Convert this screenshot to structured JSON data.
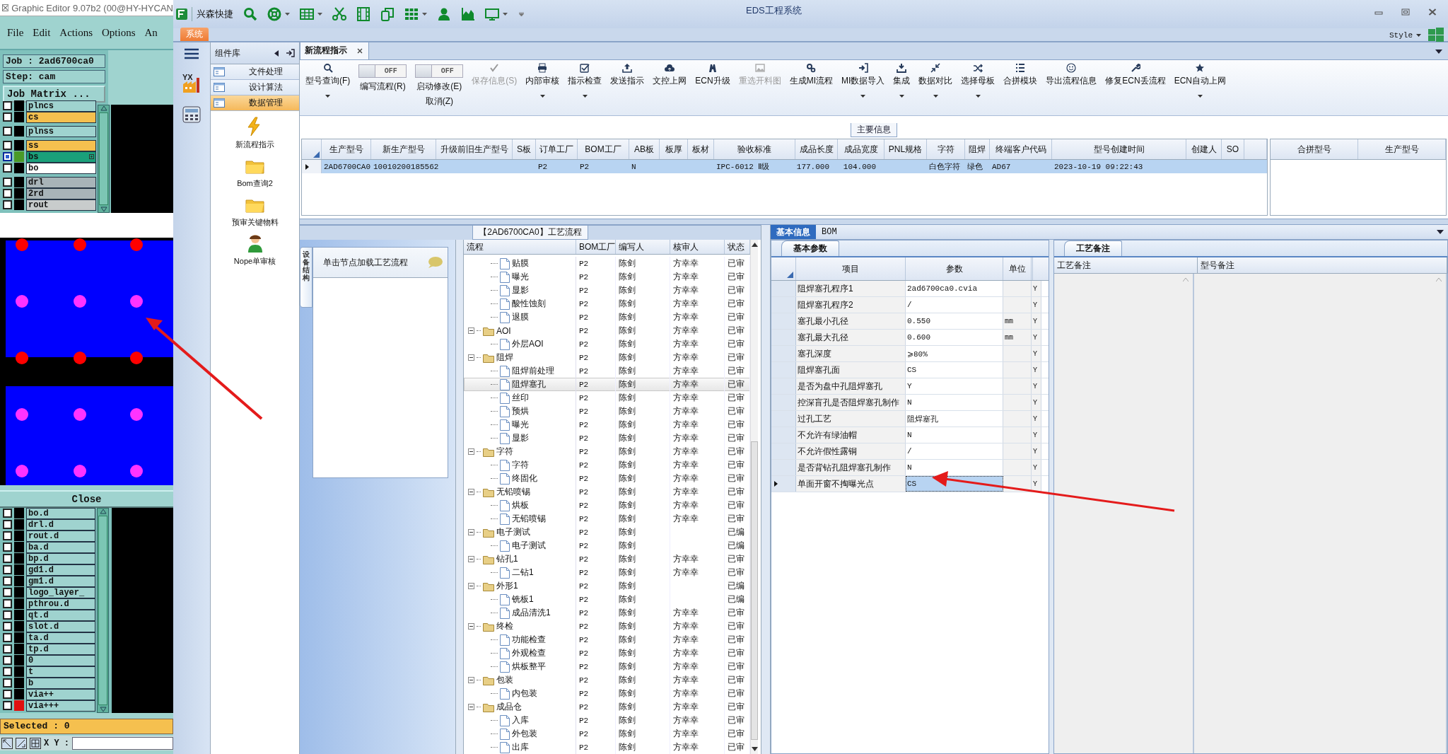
{
  "editor": {
    "title": "Graphic Editor 9.07b2 (00@HY-HYCAN",
    "menu": [
      "File",
      "Edit",
      "Actions",
      "Options",
      "An"
    ],
    "job": "Job : 2ad6700ca0",
    "step": "Step: cam",
    "matrix_button": "Job Matrix ...",
    "layers_top": [
      {
        "name": "plncs",
        "color": "#9fd3cf",
        "swatch": {
          "color": "#000000"
        },
        "selected": false,
        "gap": false
      },
      {
        "name": "cs",
        "color": "#f5c04f",
        "swatch": {
          "color": "#000000"
        },
        "selected": false,
        "gap": false
      },
      {
        "name": "plnss",
        "color": "#9fd3cf",
        "swatch": {
          "color": "#000000"
        },
        "selected": false,
        "gap": true
      },
      {
        "name": "ss",
        "color": "#f5c04f",
        "swatch": {
          "color": "#000000"
        },
        "selected": false,
        "gap": true
      },
      {
        "name": "bs",
        "color": "#1aa07a",
        "swatch": {
          "color": "#4a9a28"
        },
        "selected": true,
        "gap": false
      },
      {
        "name": "bo",
        "color": "#ffffff",
        "swatch": {
          "color": "#000000"
        },
        "selected": false,
        "gap": false
      },
      {
        "name": "drl",
        "color": "#a8b4b8",
        "swatch": {
          "color": "#000000"
        },
        "selected": false,
        "gap": true
      },
      {
        "name": "2rd",
        "color": "#a8b4b8",
        "swatch": {
          "color": "#000000"
        },
        "selected": false,
        "gap": false
      },
      {
        "name": "rout",
        "color": "#c8cccc",
        "swatch": {
          "color": "#000000"
        },
        "selected": false,
        "gap": false
      }
    ],
    "close_button": "Close",
    "layers_bottom": [
      {
        "name": "bo.d",
        "color": "#9fd3cf",
        "swatch": {
          "color": "#000000"
        },
        "selected": false
      },
      {
        "name": "drl.d",
        "color": "#9fd3cf",
        "swatch": {
          "color": "#000000"
        },
        "selected": false
      },
      {
        "name": "rout.d",
        "color": "#9fd3cf",
        "swatch": {
          "color": "#000000"
        },
        "selected": false
      },
      {
        "name": "ba.d",
        "color": "#9fd3cf",
        "swatch": {
          "color": "#000000"
        },
        "selected": false
      },
      {
        "name": "bp.d",
        "color": "#9fd3cf",
        "swatch": {
          "color": "#000000"
        },
        "selected": false
      },
      {
        "name": "gd1.d",
        "color": "#9fd3cf",
        "swatch": {
          "color": "#000000"
        },
        "selected": false
      },
      {
        "name": "gm1.d",
        "color": "#9fd3cf",
        "swatch": {
          "color": "#000000"
        },
        "selected": false
      },
      {
        "name": "logo_layer_",
        "color": "#9fd3cf",
        "swatch": {
          "color": "#000000"
        },
        "selected": false
      },
      {
        "name": "pthrou.d",
        "color": "#9fd3cf",
        "swatch": {
          "color": "#000000"
        },
        "selected": false
      },
      {
        "name": "qt.d",
        "color": "#9fd3cf",
        "swatch": {
          "color": "#000000"
        },
        "selected": false
      },
      {
        "name": "slot.d",
        "color": "#9fd3cf",
        "swatch": {
          "color": "#000000"
        },
        "selected": false
      },
      {
        "name": "ta.d",
        "color": "#9fd3cf",
        "swatch": {
          "color": "#000000"
        },
        "selected": false
      },
      {
        "name": "tp.d",
        "color": "#9fd3cf",
        "swatch": {
          "color": "#000000"
        },
        "selected": false
      },
      {
        "name": "0",
        "color": "#9fd3cf",
        "swatch": {
          "color": "#000000"
        },
        "selected": false
      },
      {
        "name": "t",
        "color": "#9fd3cf",
        "swatch": {
          "color": "#000000"
        },
        "selected": false
      },
      {
        "name": "b",
        "color": "#9fd3cf",
        "swatch": {
          "color": "#000000"
        },
        "selected": false
      },
      {
        "name": "via++",
        "color": "#9fd3cf",
        "swatch": {
          "color": "#000000"
        },
        "selected": false
      },
      {
        "name": "via+++",
        "color": "#9fd3cf",
        "swatch": {
          "color": "#e01010"
        },
        "selected": false
      }
    ],
    "selected_count": "Selected : 0",
    "coords_label": "X Y :"
  },
  "app": {
    "title": "EDS工程系统",
    "brand": "兴森快捷",
    "system_tab": "系统",
    "style_menu": "Style",
    "nav_badge": "YX"
  },
  "sidebar": {
    "title": "组件库",
    "groups": [
      {
        "label": "文件处理",
        "selected": false
      },
      {
        "label": "设计算法",
        "selected": false
      },
      {
        "label": "数据管理",
        "selected": true
      }
    ],
    "items": [
      {
        "label": "新流程指示",
        "kind": "action"
      },
      {
        "label": "Bom查询2",
        "kind": "folder"
      },
      {
        "label": "预审关键物料",
        "kind": "folder"
      },
      {
        "label": "Nope单审核",
        "kind": "user"
      }
    ]
  },
  "doc_tabs": [
    {
      "label": "新流程指示",
      "selected": true
    }
  ],
  "ribbon": [
    {
      "kind": "button",
      "label": "型号查询(F)",
      "dropdown": true,
      "disabled": false
    },
    {
      "kind": "toggle",
      "label": "编写流程(R)",
      "state_text": "OFF",
      "on": false
    },
    {
      "kind": "toggle",
      "label": "启动修改(E)",
      "second_label": "取消(Z)",
      "state_text": "OFF",
      "on": false
    },
    {
      "kind": "button",
      "label": "保存信息(S)",
      "dropdown": false,
      "disabled": true
    },
    {
      "kind": "button",
      "label": "内部审核",
      "dropdown": true,
      "disabled": false
    },
    {
      "kind": "button",
      "label": "指示检查",
      "dropdown": true,
      "disabled": false
    },
    {
      "kind": "button",
      "label": "发送指示",
      "dropdown": false,
      "disabled": false
    },
    {
      "kind": "button",
      "label": "文控上网",
      "dropdown": false,
      "disabled": false
    },
    {
      "kind": "button",
      "label": "ECN升级",
      "dropdown": false,
      "disabled": false
    },
    {
      "kind": "button",
      "label": "重选开料图",
      "dropdown": false,
      "disabled": true
    },
    {
      "kind": "button",
      "label": "生成MI流程",
      "dropdown": false,
      "disabled": false
    },
    {
      "kind": "button",
      "label": "MI数据导入",
      "dropdown": true,
      "disabled": false
    },
    {
      "kind": "button",
      "label": "集成",
      "dropdown": true,
      "disabled": false
    },
    {
      "kind": "button",
      "label": "数据对比",
      "dropdown": true,
      "disabled": false
    },
    {
      "kind": "button",
      "label": "选择母板",
      "dropdown": true,
      "disabled": false
    },
    {
      "kind": "button",
      "label": "合拼模块",
      "dropdown": false,
      "disabled": false
    },
    {
      "kind": "button",
      "label": "导出流程信息",
      "dropdown": false,
      "disabled": false
    },
    {
      "kind": "button",
      "label": "修复ECN丢流程",
      "dropdown": false,
      "disabled": false
    },
    {
      "kind": "button",
      "label": "ECN自动上网",
      "dropdown": true,
      "disabled": false
    }
  ],
  "main_info": {
    "title": "主要信息",
    "columns": [
      "生产型号",
      "新生产型号",
      "升级前旧生产型号",
      "S板",
      "订单工厂",
      "BOM工厂",
      "AB板",
      "板厚",
      "板材",
      "验收标准",
      "成品长度",
      "成品宽度",
      "PNL规格",
      "字符",
      "阻焊",
      "终端客户代码",
      "型号创建时间",
      "创建人",
      "SO"
    ],
    "rows": [
      {
        "selected": true,
        "cells": [
          "2AD6700CA0",
          "10010200185562",
          null,
          null,
          "P2",
          "P2",
          "N",
          null,
          null,
          "IPC-6012 Ⅱ级",
          "177.000",
          "104.000",
          null,
          "白色字符",
          "绿色",
          "AD67",
          "2023-10-19 09:22:43",
          null,
          null
        ]
      }
    ],
    "side_columns": [
      "合拼型号",
      "生产型号"
    ]
  },
  "process": {
    "title": "【2AD6700CA0】工艺流程",
    "side_tab": "设备结构",
    "hint": "单击节点加载工艺流程",
    "columns": [
      "流程",
      "BOM工厂",
      "编写人",
      "核审人",
      "状态"
    ],
    "tree": [
      {
        "kind": "cut-parent",
        "children": [
          {
            "kind": "step",
            "name": "贴膜",
            "bom": "P2",
            "writer": "陈剑",
            "reviewer": "方幸幸",
            "status": "已审",
            "selected": false
          },
          {
            "kind": "step",
            "name": "曝光",
            "bom": "P2",
            "writer": "陈剑",
            "reviewer": "方幸幸",
            "status": "已审",
            "selected": false
          },
          {
            "kind": "step",
            "name": "显影",
            "bom": "P2",
            "writer": "陈剑",
            "reviewer": "方幸幸",
            "status": "已审",
            "selected": false
          },
          {
            "kind": "step",
            "name": "酸性蚀刻",
            "bom": "P2",
            "writer": "陈剑",
            "reviewer": "方幸幸",
            "status": "已审",
            "selected": false
          },
          {
            "kind": "step",
            "name": "退膜",
            "bom": "P2",
            "writer": "陈剑",
            "reviewer": "方幸幸",
            "status": "已审",
            "selected": false
          }
        ]
      },
      {
        "kind": "group",
        "name": "AOI",
        "bom": "P2",
        "writer": "陈剑",
        "reviewer": "方幸幸",
        "status": "已审",
        "selected": false,
        "expanded": true,
        "children": [
          {
            "kind": "step",
            "name": "外层AOI",
            "bom": "P2",
            "writer": "陈剑",
            "reviewer": "方幸幸",
            "status": "已审",
            "selected": false
          }
        ]
      },
      {
        "kind": "group",
        "name": "阻焊",
        "bom": "P2",
        "writer": "陈剑",
        "reviewer": "方幸幸",
        "status": "已审",
        "selected": false,
        "expanded": true,
        "children": [
          {
            "kind": "step",
            "name": "阻焊前处理",
            "bom": "P2",
            "writer": "陈剑",
            "reviewer": "方幸幸",
            "status": "已审",
            "selected": false
          },
          {
            "kind": "step",
            "name": "阻焊塞孔",
            "bom": "P2",
            "writer": "陈剑",
            "reviewer": "方幸幸",
            "status": "已审",
            "selected": true
          },
          {
            "kind": "step",
            "name": "丝印",
            "bom": "P2",
            "writer": "陈剑",
            "reviewer": "方幸幸",
            "status": "已审",
            "selected": false
          },
          {
            "kind": "step",
            "name": "预烘",
            "bom": "P2",
            "writer": "陈剑",
            "reviewer": "方幸幸",
            "status": "已审",
            "selected": false
          },
          {
            "kind": "step",
            "name": "曝光",
            "bom": "P2",
            "writer": "陈剑",
            "reviewer": "方幸幸",
            "status": "已审",
            "selected": false
          },
          {
            "kind": "step",
            "name": "显影",
            "bom": "P2",
            "writer": "陈剑",
            "reviewer": "方幸幸",
            "status": "已审",
            "selected": false
          }
        ]
      },
      {
        "kind": "group",
        "name": "字符",
        "bom": "P2",
        "writer": "陈剑",
        "reviewer": "方幸幸",
        "status": "已审",
        "selected": false,
        "expanded": true,
        "children": [
          {
            "kind": "step",
            "name": "字符",
            "bom": "P2",
            "writer": "陈剑",
            "reviewer": "方幸幸",
            "status": "已审",
            "selected": false
          },
          {
            "kind": "step",
            "name": "终固化",
            "bom": "P2",
            "writer": "陈剑",
            "reviewer": "方幸幸",
            "status": "已审",
            "selected": false
          }
        ]
      },
      {
        "kind": "group",
        "name": "无铅喷锡",
        "bom": "P2",
        "writer": "陈剑",
        "reviewer": "方幸幸",
        "status": "已审",
        "selected": false,
        "expanded": true,
        "children": [
          {
            "kind": "step",
            "name": "烘板",
            "bom": "P2",
            "writer": "陈剑",
            "reviewer": "方幸幸",
            "status": "已审",
            "selected": false
          },
          {
            "kind": "step",
            "name": "无铅喷锡",
            "bom": "P2",
            "writer": "陈剑",
            "reviewer": "方幸幸",
            "status": "已审",
            "selected": false
          }
        ]
      },
      {
        "kind": "group",
        "name": "电子测试",
        "bom": "P2",
        "writer": "陈剑",
        "status": "已编",
        "selected": false,
        "expanded": true,
        "children": [
          {
            "kind": "step",
            "name": "电子测试",
            "bom": "P2",
            "writer": "陈剑",
            "status": "已编",
            "selected": false
          }
        ]
      },
      {
        "kind": "group",
        "name": "钻孔1",
        "bom": "P2",
        "writer": "陈剑",
        "reviewer": "方幸幸",
        "status": "已审",
        "selected": false,
        "expanded": true,
        "children": [
          {
            "kind": "step",
            "name": "二钻1",
            "bom": "P2",
            "writer": "陈剑",
            "reviewer": "方幸幸",
            "status": "已审",
            "selected": false
          }
        ]
      },
      {
        "kind": "group",
        "name": "外形1",
        "bom": "P2",
        "writer": "陈剑",
        "status": "已编",
        "selected": false,
        "expanded": true,
        "children": [
          {
            "kind": "step",
            "name": "铣板1",
            "bom": "P2",
            "writer": "陈剑",
            "status": "已编",
            "selected": false
          },
          {
            "kind": "step",
            "name": "成品清洗1",
            "bom": "P2",
            "writer": "陈剑",
            "reviewer": "方幸幸",
            "status": "已审",
            "selected": false
          }
        ]
      },
      {
        "kind": "group",
        "name": "终检",
        "bom": "P2",
        "writer": "陈剑",
        "reviewer": "方幸幸",
        "status": "已审",
        "selected": false,
        "expanded": true,
        "children": [
          {
            "kind": "step",
            "name": "功能检查",
            "bom": "P2",
            "writer": "陈剑",
            "reviewer": "方幸幸",
            "status": "已审",
            "selected": false
          },
          {
            "kind": "step",
            "name": "外观检查",
            "bom": "P2",
            "writer": "陈剑",
            "reviewer": "方幸幸",
            "status": "已审",
            "selected": false
          },
          {
            "kind": "step",
            "name": "烘板整平",
            "bom": "P2",
            "writer": "陈剑",
            "reviewer": "方幸幸",
            "status": "已审",
            "selected": false
          }
        ]
      },
      {
        "kind": "group",
        "name": "包装",
        "bom": "P2",
        "writer": "陈剑",
        "reviewer": "方幸幸",
        "status": "已审",
        "selected": false,
        "expanded": true,
        "children": [
          {
            "kind": "step",
            "name": "内包装",
            "bom": "P2",
            "writer": "陈剑",
            "reviewer": "方幸幸",
            "status": "已审",
            "selected": false
          }
        ]
      },
      {
        "kind": "group",
        "name": "成品仓",
        "bom": "P2",
        "writer": "陈剑",
        "reviewer": "方幸幸",
        "status": "已审",
        "selected": false,
        "expanded": true,
        "children": [
          {
            "kind": "step",
            "name": "入库",
            "bom": "P2",
            "writer": "陈剑",
            "reviewer": "方幸幸",
            "status": "已审",
            "selected": false
          },
          {
            "kind": "step",
            "name": "外包装",
            "bom": "P2",
            "writer": "陈剑",
            "reviewer": "方幸幸",
            "status": "已审",
            "selected": false
          },
          {
            "kind": "step",
            "name": "出库",
            "bom": "P2",
            "writer": "陈剑",
            "reviewer": "方幸幸",
            "status": "已审",
            "selected": false
          }
        ]
      }
    ]
  },
  "detail": {
    "tabs": [
      {
        "label": "基本信息",
        "selected": true
      },
      {
        "label": "BOM",
        "selected": false
      }
    ],
    "params": {
      "tab": "基本参数",
      "columns": [
        "项目",
        "参数",
        "单位"
      ],
      "rows": [
        {
          "item": "阻焊塞孔程序1",
          "value": "2ad6700ca0.cvia",
          "column_4": "Y",
          "selected": false
        },
        {
          "item": "阻焊塞孔程序2",
          "value": "/",
          "column_4": "Y",
          "selected": false
        },
        {
          "item": "塞孔最小孔径",
          "value": "0.550",
          "unit": "mm",
          "column_4": "Y",
          "selected": false
        },
        {
          "item": "塞孔最大孔径",
          "value": "0.600",
          "unit": "mm",
          "column_4": "Y",
          "selected": false
        },
        {
          "item": "塞孔深度",
          "value": "⩾80%",
          "column_4": "Y",
          "selected": false
        },
        {
          "item": "阻焊塞孔面",
          "value": "CS",
          "column_4": "Y",
          "selected": false
        },
        {
          "item": "是否为盘中孔阻焊塞孔",
          "value": "Y",
          "column_4": "Y",
          "selected": false
        },
        {
          "item": "控深盲孔是否阻焊塞孔制作",
          "value": "N",
          "column_4": "Y",
          "selected": false
        },
        {
          "item": "过孔工艺",
          "value": "阻焊塞孔",
          "column_4": "Y",
          "selected": false
        },
        {
          "item": "不允许有绿油帽",
          "value": "N",
          "column_4": "Y",
          "selected": false
        },
        {
          "item": "不允许假性露铜",
          "value": "/",
          "column_4": "Y",
          "selected": false
        },
        {
          "item": "是否背钻孔阻焊塞孔制作",
          "value": "N",
          "column_4": "Y",
          "selected": false
        },
        {
          "item": "单面开窗不掏曝光点",
          "value": "CS",
          "column_4": "Y",
          "selected": true
        }
      ]
    },
    "notes": {
      "tab": "工艺备注",
      "columns": [
        "工艺备注",
        "型号备注"
      ]
    }
  }
}
